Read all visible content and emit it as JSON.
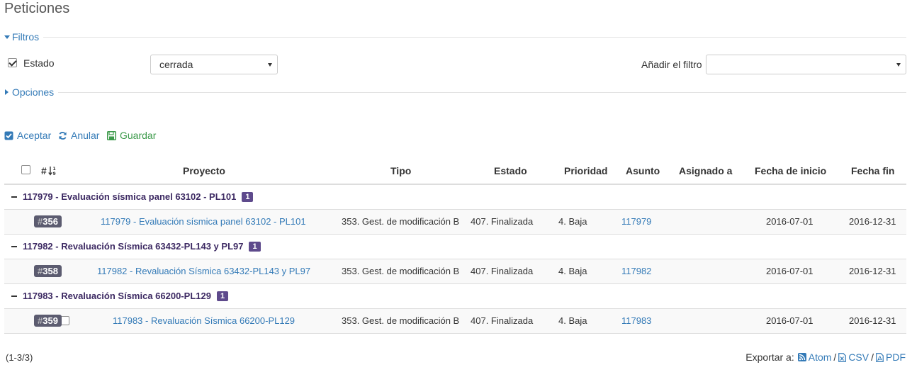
{
  "page": {
    "title": "Peticiones"
  },
  "filters": {
    "legend": "Filtros",
    "estado_label": "Estado",
    "estado_value": "cerrada",
    "add_filter_label": "Añadir el filtro",
    "add_filter_value": ""
  },
  "options": {
    "legend": "Opciones"
  },
  "actions": {
    "accept": "Aceptar",
    "reset": "Anular",
    "save": "Guardar"
  },
  "table": {
    "headers": {
      "id": "#",
      "proyecto": "Proyecto",
      "tipo": "Tipo",
      "estado": "Estado",
      "prioridad": "Prioridad",
      "asunto": "Asunto",
      "asignado": "Asignado a",
      "fecha_inicio": "Fecha de inicio",
      "fecha_fin": "Fecha fin"
    },
    "groups": [
      {
        "title": "117979 - Evaluación sísmica panel 63102 - PL101",
        "count": "1",
        "row": {
          "id": "356",
          "proyecto": "117979 - Evaluación sísmica panel 63102 - PL101",
          "tipo": "353. Gest. de modificación B",
          "estado": "407. Finalizada",
          "prioridad": "4. Baja",
          "asunto": "117979",
          "asignado": "",
          "fecha_inicio": "2016-07-01",
          "fecha_fin": "2016-12-31"
        }
      },
      {
        "title": "117982 - Revaluación Sísmica 63432-PL143 y PL97",
        "count": "1",
        "row": {
          "id": "358",
          "proyecto": "117982 - Revaluación Sísmica 63432-PL143 y PL97",
          "tipo": "353. Gest. de modificación B",
          "estado": "407. Finalizada",
          "prioridad": "4. Baja",
          "asunto": "117982",
          "asignado": "",
          "fecha_inicio": "2016-07-01",
          "fecha_fin": "2016-12-31"
        }
      },
      {
        "title": "117983 - Revaluación Sísmica 66200-PL129",
        "count": "1",
        "row": {
          "id": "359",
          "proyecto": "117983 - Revaluación Sísmica 66200-PL129",
          "tipo": "353. Gest. de modificación B",
          "estado": "407. Finalizada",
          "prioridad": "4. Baja",
          "asunto": "117983",
          "asignado": "",
          "fecha_inicio": "2016-07-01",
          "fecha_fin": "2016-12-31"
        }
      }
    ]
  },
  "footer": {
    "count": "(1-3/3)",
    "export_label": "Exportar a:",
    "atom": "Atom",
    "csv": "CSV",
    "pdf": "PDF",
    "separator": "/"
  },
  "icons": {
    "accept": "checkbox-checked-icon",
    "reset": "refresh-icon",
    "save": "floppy-icon",
    "sort": "sort-numeric-icon",
    "atom": "rss-icon",
    "csv": "excel-file-icon",
    "pdf": "pdf-file-icon"
  },
  "colors": {
    "link": "#337ab7",
    "save": "#3c9a4a",
    "group_title": "#3d2a63",
    "count_badge": "#5e4a8c",
    "id_badge": "#5c5c70"
  }
}
